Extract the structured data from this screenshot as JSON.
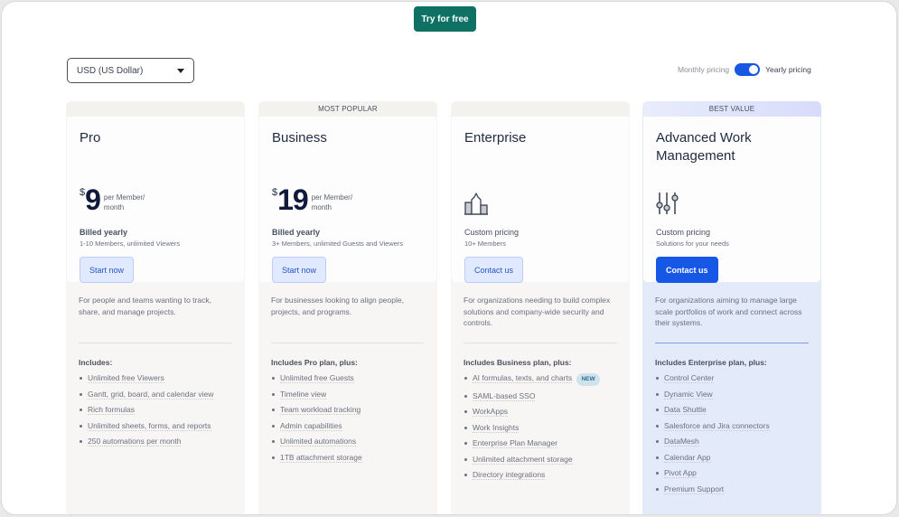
{
  "header": {
    "try_button": "Try for free",
    "currency": "USD (US Dollar)",
    "toggle": {
      "monthly_label": "Monthly pricing",
      "yearly_label": "Yearly pricing",
      "selected": "yearly"
    }
  },
  "plans": [
    {
      "banner": "",
      "name": "Pro",
      "currency_symbol": "$",
      "price": "9",
      "per": "per Member/ month",
      "billing": "Billed yearly",
      "subtitle": "1-10 Members, unlimited Viewers",
      "cta": "Start now",
      "description": "For people and teams wanting to track, share, and manage projects.",
      "includes_title": "Includes:",
      "features": [
        "Unlimited free Viewers",
        "Gantt, grid, board, and calendar view",
        "Rich formulas",
        "Unlimited sheets, forms, and reports",
        "250 automations per month"
      ]
    },
    {
      "banner": "MOST POPULAR",
      "name": "Business",
      "currency_symbol": "$",
      "price": "19",
      "per": "per Member/ month",
      "billing": "Billed yearly",
      "subtitle": "3+ Members, unlimited Guests and Viewers",
      "cta": "Start now",
      "description": "For businesses looking to align people, projects, and programs.",
      "includes_title": "Includes Pro plan, plus:",
      "features": [
        "Unlimited free Guests",
        "Timeline view",
        "Team workload tracking",
        "Admin capabilities",
        "Unlimited automations",
        "1TB attachment storage"
      ]
    },
    {
      "banner": "",
      "name": "Enterprise",
      "icon": "building-icon",
      "billing": "Custom pricing",
      "subtitle": "10+ Members",
      "cta": "Contact us",
      "description": "For organizations needing to build complex solutions and company-wide security and controls.",
      "includes_title": "Includes Business plan, plus:",
      "features": [
        "AI formulas, texts, and charts",
        "SAML-based SSO",
        "WorkApps",
        "Work Insights",
        "Enterprise Plan Manager",
        "Unlimited attachment storage",
        "Directory integrations"
      ],
      "new_badge": "NEW"
    },
    {
      "banner": "BEST VALUE",
      "name": "Advanced Work Management",
      "icon": "sliders-icon",
      "billing": "Custom pricing",
      "subtitle": "Solutions for your needs",
      "cta": "Contact us",
      "description": "For organizations aiming to manage large scale portfolios of work and connect across their systems.",
      "includes_title": "Includes Enterprise plan, plus:",
      "features": [
        "Control Center",
        "Dynamic View",
        "Data Shuttle",
        "Salesforce and Jira connectors",
        "DataMesh",
        "Calendar App",
        "Pivot App",
        "Premium Support"
      ]
    }
  ],
  "colors": {
    "brand_green": "#0e7163",
    "primary_blue": "#1757e6",
    "awm_bg": "#e3eaf9"
  }
}
